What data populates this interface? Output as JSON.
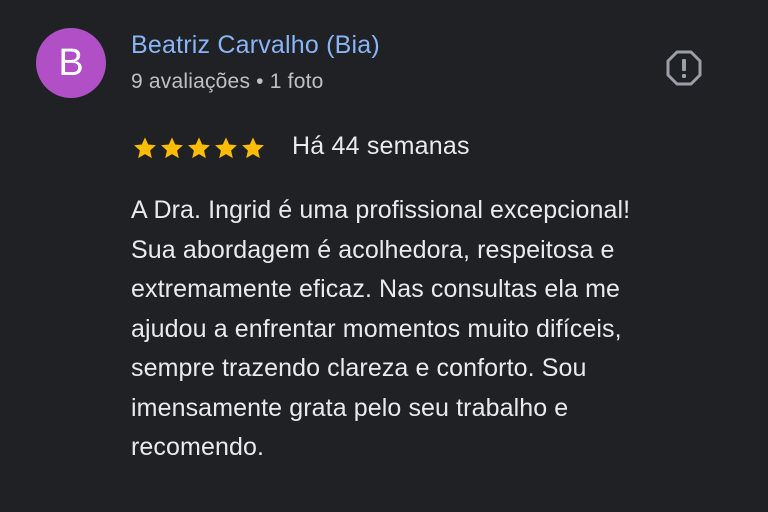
{
  "review": {
    "author": {
      "avatar_letter": "B",
      "avatar_color": "#b04fc6",
      "name": "Beatriz Carvalho (Bia)",
      "meta": "9 avaliações • 1 foto"
    },
    "report_icon": "report-octagon-icon",
    "rating": 5,
    "rating_max": 5,
    "star_color": "#fbbc04",
    "date": "Há 44 semanas",
    "text_lines": [
      "A Dra. Ingrid é uma profissional excepcional!",
      "Sua abordagem é acolhedora, respeitosa e",
      "extremamente eficaz. Nas consultas ela me",
      "ajudou a enfrentar momentos muito difíceis,",
      "sempre trazendo clareza e conforto. Sou",
      "imensamente grata pelo seu trabalho e",
      "recomendo."
    ]
  }
}
